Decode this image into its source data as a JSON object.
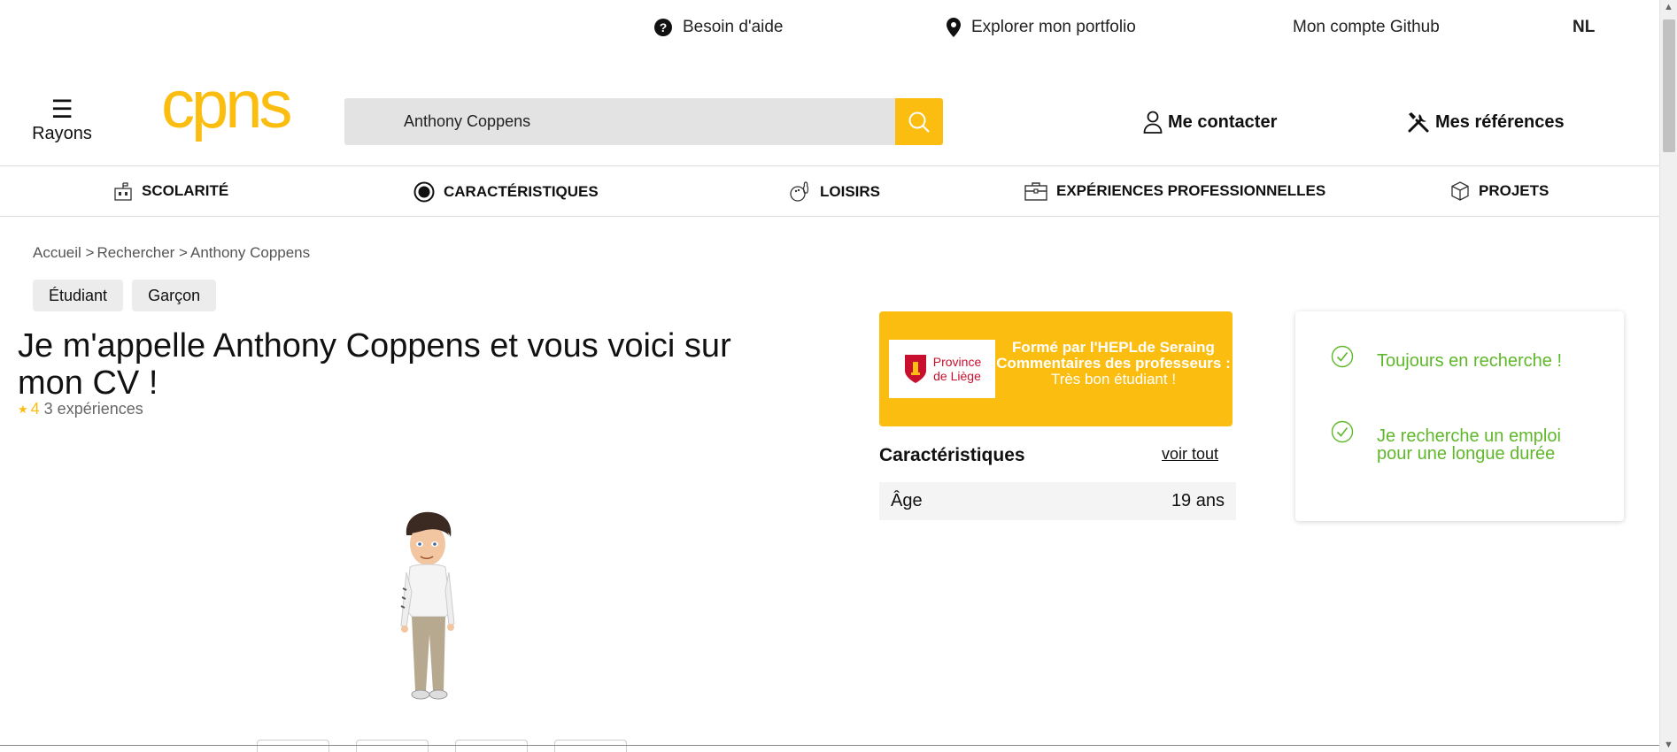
{
  "utility_bar": {
    "help": "Besoin d'aide",
    "portfolio": "Explorer mon portfolio",
    "github": "Mon compte Github",
    "language": "NL"
  },
  "header": {
    "menu_label": "Rayons",
    "logo_text": "cpns",
    "search": {
      "value": "Anthony Coppens",
      "placeholder": ""
    },
    "contact": "Me contacter",
    "references": "Mes références"
  },
  "categories": [
    {
      "label": "SCOLARITÉ",
      "icon": "school-icon"
    },
    {
      "label": "CARACTÉRISTIQUES",
      "icon": "target-icon"
    },
    {
      "label": "LOISIRS",
      "icon": "bowling-icon"
    },
    {
      "label": "EXPÉRIENCES PROFESSIONNELLES",
      "icon": "briefcase-icon"
    },
    {
      "label": "PROJETS",
      "icon": "box-icon"
    }
  ],
  "breadcrumb": [
    "Accueil >",
    "Rechercher >",
    "Anthony Coppens"
  ],
  "tags": [
    "Étudiant",
    "Garçon"
  ],
  "main": {
    "title": "Je m'appelle Anthony Coppens et vous voici sur mon CV !",
    "rating": "4",
    "experiences": "3 expériences"
  },
  "promo": {
    "logo_line1": "Province",
    "logo_line2": "de Liège",
    "line1": "Formé par l'HEPLde Seraing",
    "line2": "Commentaires des professeurs :",
    "line3": "Très bon étudiant !"
  },
  "caracteristiques": {
    "title": "Caractéristiques",
    "see_all": "voir tout",
    "rows": [
      {
        "label": "Âge",
        "value": "19 ans"
      }
    ]
  },
  "status": [
    "Toujours en recherche !",
    "Je recherche un emploi pour une longue durée"
  ],
  "colors": {
    "brand": "#fbbd10",
    "status_green": "#5fb82a"
  }
}
